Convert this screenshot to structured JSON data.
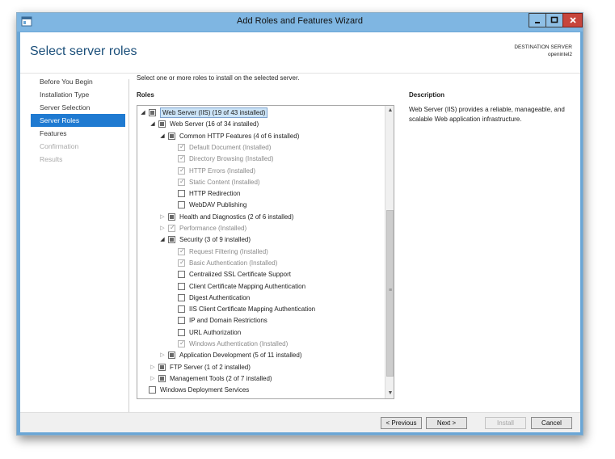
{
  "window": {
    "title": "Add Roles and Features Wizard"
  },
  "header": {
    "page_title": "Select server roles",
    "destination_label": "DESTINATION SERVER",
    "destination_server": "openintel2"
  },
  "nav": {
    "items": [
      {
        "label": "Before You Begin",
        "state": "normal"
      },
      {
        "label": "Installation Type",
        "state": "normal"
      },
      {
        "label": "Server Selection",
        "state": "normal"
      },
      {
        "label": "Server Roles",
        "state": "active"
      },
      {
        "label": "Features",
        "state": "normal"
      },
      {
        "label": "Confirmation",
        "state": "disabled"
      },
      {
        "label": "Results",
        "state": "disabled"
      }
    ]
  },
  "main": {
    "instruction": "Select one or more roles to install on the selected server.",
    "roles_label": "Roles",
    "description_label": "Description",
    "description_text": "Web Server (IIS) provides a reliable, manageable, and scalable Web application infrastructure."
  },
  "tree": {
    "items": [
      {
        "label": "Web Server (IIS) (19 of 43 installed)",
        "level": 0,
        "expander": "expanded",
        "check": "partial",
        "grey": false,
        "selected": true
      },
      {
        "label": "Web Server (16 of 34 installed)",
        "level": 1,
        "expander": "expanded",
        "check": "partial",
        "grey": false
      },
      {
        "label": "Common HTTP Features (4 of 6 installed)",
        "level": 2,
        "expander": "expanded",
        "check": "partial",
        "grey": false
      },
      {
        "label": "Default Document (Installed)",
        "level": 3,
        "expander": "none",
        "check": "checked",
        "grey": true
      },
      {
        "label": "Directory Browsing (Installed)",
        "level": 3,
        "expander": "none",
        "check": "checked",
        "grey": true
      },
      {
        "label": "HTTP Errors (Installed)",
        "level": 3,
        "expander": "none",
        "check": "checked",
        "grey": true
      },
      {
        "label": "Static Content (Installed)",
        "level": 3,
        "expander": "none",
        "check": "checked",
        "grey": true
      },
      {
        "label": "HTTP Redirection",
        "level": 3,
        "expander": "none",
        "check": "unchecked",
        "grey": false
      },
      {
        "label": "WebDAV Publishing",
        "level": 3,
        "expander": "none",
        "check": "unchecked",
        "grey": false
      },
      {
        "label": "Health and Diagnostics (2 of 6 installed)",
        "level": 2,
        "expander": "collapsed",
        "check": "partial",
        "grey": false
      },
      {
        "label": "Performance (Installed)",
        "level": 2,
        "expander": "collapsed",
        "check": "checked",
        "grey": true
      },
      {
        "label": "Security (3 of 9 installed)",
        "level": 2,
        "expander": "expanded",
        "check": "partial",
        "grey": false
      },
      {
        "label": "Request Filtering (Installed)",
        "level": 3,
        "expander": "none",
        "check": "checked",
        "grey": true
      },
      {
        "label": "Basic Authentication (Installed)",
        "level": 3,
        "expander": "none",
        "check": "checked",
        "grey": true
      },
      {
        "label": "Centralized SSL Certificate Support",
        "level": 3,
        "expander": "none",
        "check": "unchecked",
        "grey": false
      },
      {
        "label": "Client Certificate Mapping Authentication",
        "level": 3,
        "expander": "none",
        "check": "unchecked",
        "grey": false
      },
      {
        "label": "Digest Authentication",
        "level": 3,
        "expander": "none",
        "check": "unchecked",
        "grey": false
      },
      {
        "label": "IIS Client Certificate Mapping Authentication",
        "level": 3,
        "expander": "none",
        "check": "unchecked",
        "grey": false
      },
      {
        "label": "IP and Domain Restrictions",
        "level": 3,
        "expander": "none",
        "check": "unchecked",
        "grey": false
      },
      {
        "label": "URL Authorization",
        "level": 3,
        "expander": "none",
        "check": "unchecked",
        "grey": false
      },
      {
        "label": "Windows Authentication (Installed)",
        "level": 3,
        "expander": "none",
        "check": "checked",
        "grey": true
      },
      {
        "label": "Application Development (5 of 11 installed)",
        "level": 2,
        "expander": "collapsed",
        "check": "partial",
        "grey": false
      },
      {
        "label": "FTP Server (1 of 2 installed)",
        "level": 1,
        "expander": "collapsed",
        "check": "partial",
        "grey": false
      },
      {
        "label": "Management Tools (2 of 7 installed)",
        "level": 1,
        "expander": "collapsed",
        "check": "partial",
        "grey": false
      },
      {
        "label": "Windows Deployment Services",
        "level": 0,
        "expander": "none",
        "check": "unchecked",
        "grey": false
      }
    ]
  },
  "footer": {
    "previous_label": "< Previous",
    "next_label": "Next >",
    "install_label": "Install",
    "cancel_label": "Cancel"
  },
  "colors": {
    "accent": "#1f7ad1",
    "title_text": "#1b4f7a",
    "titlebar": "#7fb6e2",
    "close_button": "#c7453c",
    "selection": "#cce4f7"
  },
  "icons": [
    "server-manager-icon",
    "minimize-icon",
    "maximize-icon",
    "close-icon",
    "expand-arrow-icon",
    "collapse-arrow-icon",
    "scroll-up-icon",
    "scroll-down-icon",
    "scroll-grip-icon"
  ]
}
